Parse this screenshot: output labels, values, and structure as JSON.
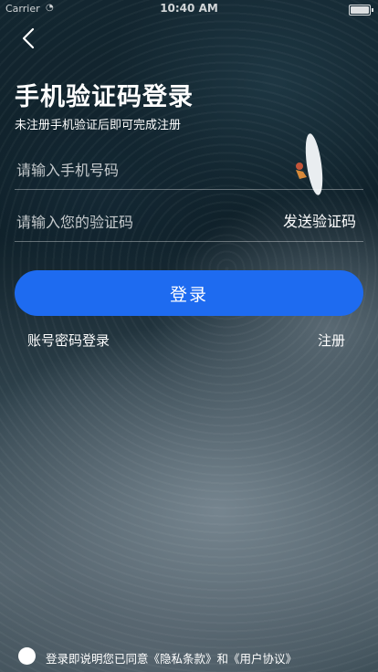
{
  "status_bar": {
    "carrier": "Carrier",
    "time": "10:40 AM"
  },
  "header": {
    "title": "手机验证码登录",
    "subtitle": "未注册手机验证后即可完成注册"
  },
  "form": {
    "phone_placeholder": "请输入手机号码",
    "code_placeholder": "请输入您的验证码",
    "send_code_label": "发送验证码",
    "login_label": "登录"
  },
  "links": {
    "password_login": "账号密码登录",
    "register": "注册"
  },
  "agreement": {
    "prefix": "登录即说明您已同意",
    "privacy": "《隐私条款》",
    "and": "和",
    "user_agreement": "《用户协议》"
  },
  "colors": {
    "primary_button": "#1e6bf0"
  },
  "icons": {
    "back": "chevron-left-icon",
    "radio": "unchecked-radio-icon"
  }
}
